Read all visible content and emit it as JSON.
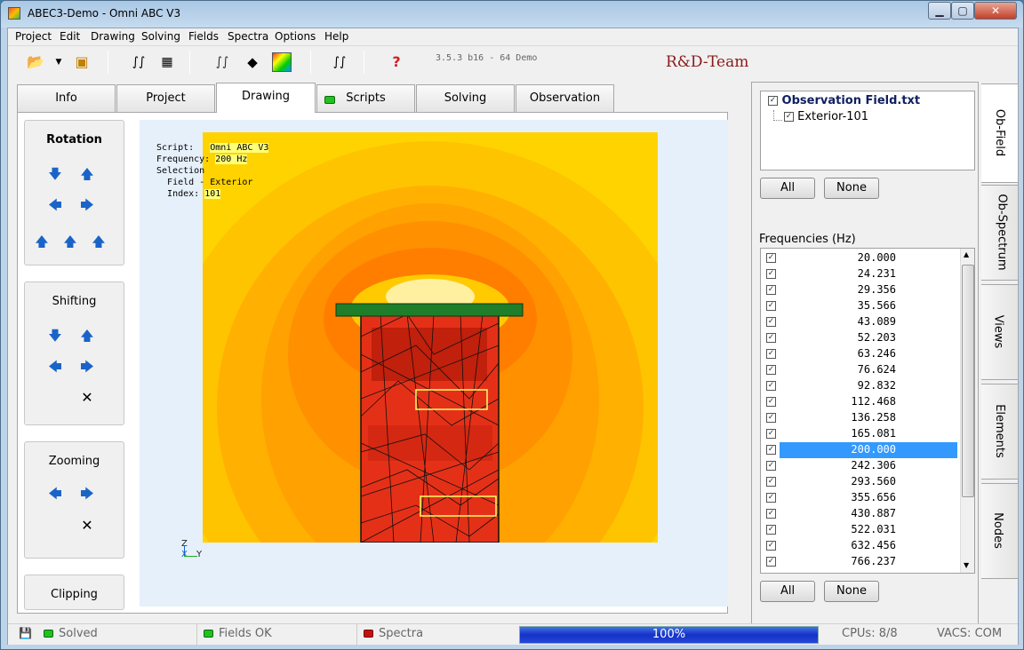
{
  "window": {
    "title": "ABEC3-Demo - Omni ABC V3",
    "minimize": "▁",
    "maximize": "▢",
    "close": "✕"
  },
  "menu": [
    "Project",
    "Edit",
    "Drawing",
    "Solving",
    "Fields",
    "Spectra",
    "Options",
    "Help"
  ],
  "toolbar": {
    "version": "3.5.3 b16 - 64 Demo",
    "brand": "R&D-Team",
    "help": "?"
  },
  "tabs": [
    {
      "label": "Info"
    },
    {
      "label": "Project"
    },
    {
      "label": "Drawing",
      "active": true
    },
    {
      "label": "Scripts",
      "led": "#22c122"
    },
    {
      "label": "Solving"
    },
    {
      "label": "Observation"
    }
  ],
  "groups": {
    "rotation": "Rotation",
    "shifting": "Shifting",
    "zooming": "Zooming",
    "clipping": "Clipping"
  },
  "overlay": {
    "script_key": "Script:",
    "script_val": "Omni ABC V3",
    "freq_key": "Frequency:",
    "freq_val": "200 Hz",
    "selection": "Selection",
    "field_line": "Field - Exterior",
    "index_key": "Index:",
    "index_val": "101"
  },
  "axes": {
    "z": "Z",
    "x": "X",
    "y": "Y"
  },
  "obs_tree": {
    "root": "Observation Field.txt",
    "child": "Exterior-101"
  },
  "buttons": {
    "all": "All",
    "none": "None"
  },
  "frequencies_label": "Frequencies  (Hz)",
  "frequencies": [
    "20.000",
    "24.231",
    "29.356",
    "35.566",
    "43.089",
    "52.203",
    "63.246",
    "76.624",
    "92.832",
    "112.468",
    "136.258",
    "165.081",
    "200.000",
    "242.306",
    "293.560",
    "355.656",
    "430.887",
    "522.031",
    "632.456",
    "766.237"
  ],
  "selected_frequency": "200.000",
  "side_tabs": [
    "Ob-Field",
    "Ob-Spectrum",
    "Views",
    "Elements",
    "Nodes"
  ],
  "status": {
    "solved": "Solved",
    "fields": "Fields OK",
    "spectra": "Spectra",
    "progress": "100%",
    "cpus": "CPUs: 8/8",
    "vacs": "VACS: COM"
  },
  "colors": {
    "field_bg": "#ffd300",
    "hot": "#e8301a",
    "green_led": "#22c122",
    "red_led": "#c41010",
    "selection": "#3399ff"
  }
}
